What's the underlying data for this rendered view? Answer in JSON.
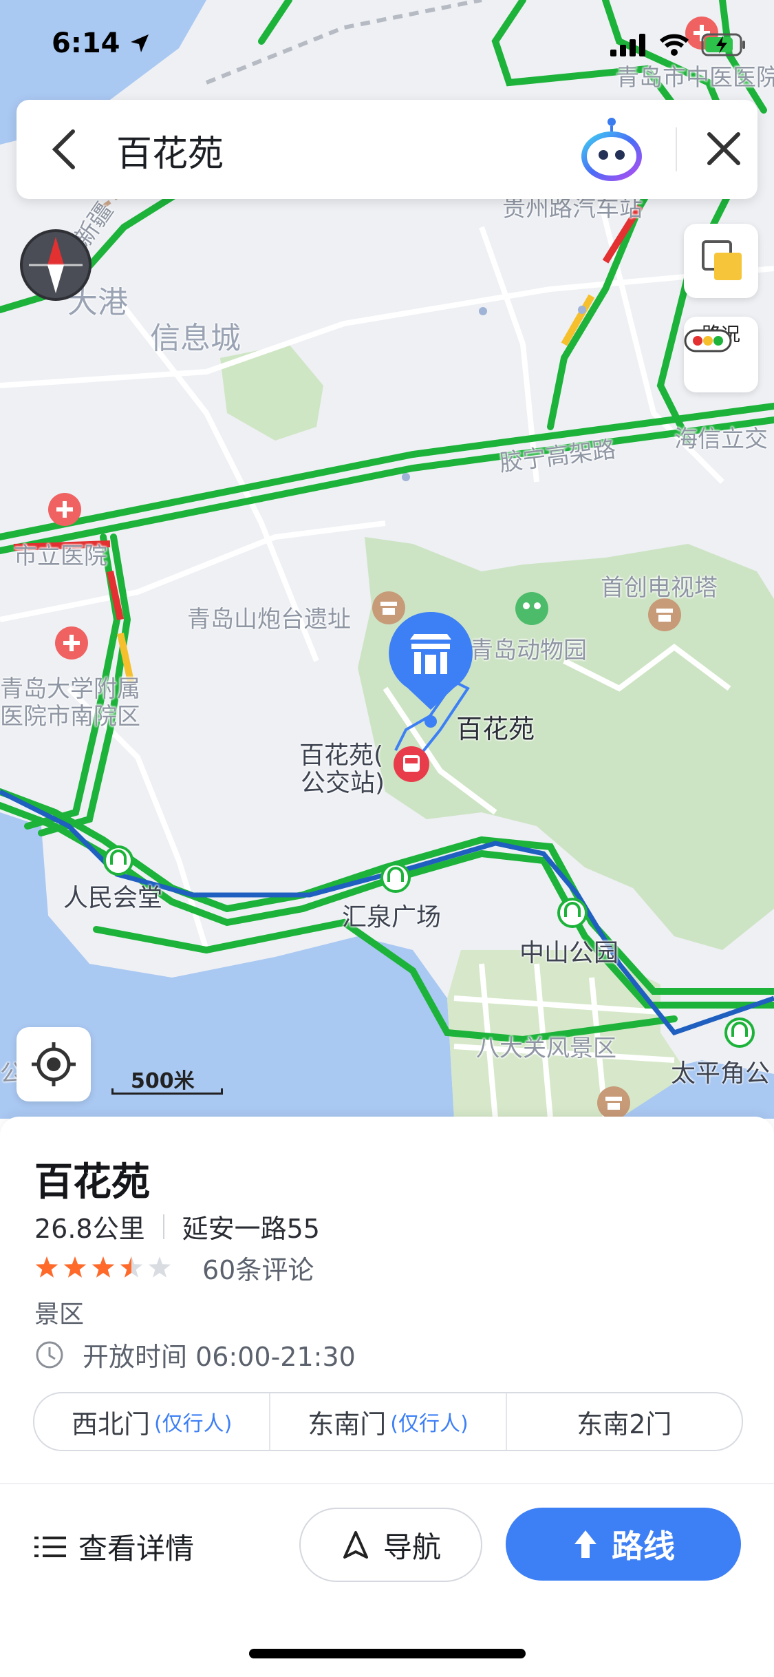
{
  "status_bar": {
    "time": "6:14"
  },
  "search": {
    "query": "百花苑"
  },
  "map": {
    "labels": {
      "hospital_top": "青岛市中医医院",
      "bus_station_top": "贵州路汽车站",
      "xinjiang": "新疆",
      "dagang": "大港",
      "xinxicheng": "信息城",
      "jiaoning": "胶宁高架路",
      "haixin": "海信立交",
      "city_hospital": "市立医院",
      "shouchuang": "首创电视塔",
      "fortress": "青岛山炮台遗址",
      "zoo": "青岛动物园",
      "qdu_hospital_1": "青岛大学附属",
      "qdu_hospital_2": "医院市南院区",
      "place": "百花苑",
      "bus_stop_1": "百花苑(",
      "bus_stop_2": "公交站)",
      "renmin": "人民会堂",
      "huiquan": "汇泉广场",
      "zhongshan": "中山公园",
      "badaguan": "八大关风景区",
      "taipingjiao": "太平角公",
      "edge_gong": "公"
    },
    "traffic_button_label": "路况",
    "scale_label": "500米"
  },
  "place": {
    "name": "百花苑",
    "distance": "26.8公里",
    "address": "延安一路55",
    "rating": 3.5,
    "rating_max": 5,
    "reviews": "60条评论",
    "category": "景区",
    "hours": "开放时间 06:00-21:30",
    "gates": [
      {
        "name": "西北门",
        "tag": "(仅行人)"
      },
      {
        "name": "东南门",
        "tag": "(仅行人)"
      },
      {
        "name": "东南2门",
        "tag": ""
      }
    ]
  },
  "actions": {
    "details": "查看详情",
    "navigate": "导航",
    "route": "路线"
  },
  "colors": {
    "accent": "#3d7ff5",
    "traffic_green": "#1db33a",
    "metro_blue": "#1f5fbf",
    "star": "#ff6a2a"
  }
}
